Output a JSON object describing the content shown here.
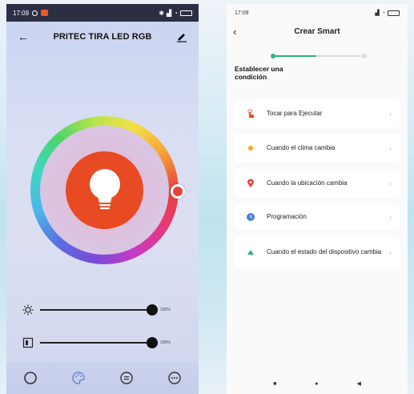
{
  "left_phone": {
    "status_time": "17:09",
    "header_title": "PRITEC TIRA LED RGB",
    "sliders": [
      {
        "name": "brightness",
        "value_label": "100%",
        "value": 1.0
      },
      {
        "name": "contrast",
        "value_label": "100%",
        "value": 1.0
      }
    ],
    "colors": {
      "bulb": "#e84a24",
      "knob": "#e8413c"
    }
  },
  "right_phone": {
    "status_time": "17:09",
    "header_title": "Crear Smart",
    "section_title": "Establecer una condición",
    "options": [
      {
        "label": "Tocar para Ejecutar",
        "icon": "hand-tap-icon",
        "color": "#e84a24"
      },
      {
        "label": "Cuando el clima cambia",
        "icon": "sun-icon",
        "color": "#f5a623"
      },
      {
        "label": "Cuando la ubicación cambia",
        "icon": "location-pin-icon",
        "color": "#e8413c"
      },
      {
        "label": "Programación",
        "icon": "clock-icon",
        "color": "#4a7fd8"
      },
      {
        "label": "Cuando el estado del dispositivo cambia",
        "icon": "device-icon",
        "color": "#2fb37a"
      }
    ],
    "accent": "#2fb37a"
  }
}
